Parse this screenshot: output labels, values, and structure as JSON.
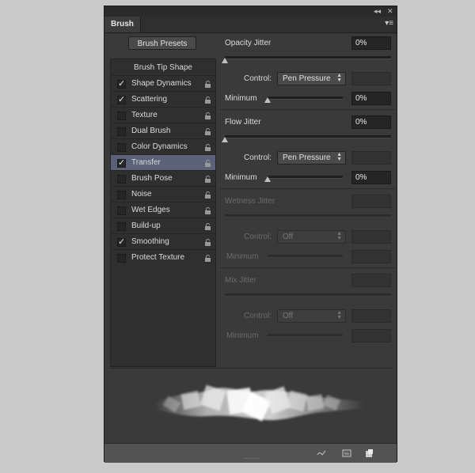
{
  "panel": {
    "tab_title": "Brush",
    "collapse_glyph": "◂◂",
    "close_glyph": "✕",
    "menu_glyph": "▾≡"
  },
  "brush_presets_button": "Brush Presets",
  "brush_list": {
    "heading": "Brush Tip Shape",
    "items": [
      {
        "label": "Shape Dynamics",
        "checked": "✓"
      },
      {
        "label": "Scattering",
        "checked": "✓"
      },
      {
        "label": "Texture",
        "checked": ""
      },
      {
        "label": "Dual Brush",
        "checked": ""
      },
      {
        "label": "Color Dynamics",
        "checked": ""
      },
      {
        "label": "Transfer",
        "checked": "✓"
      },
      {
        "label": "Brush Pose",
        "checked": ""
      },
      {
        "label": "Noise",
        "checked": ""
      },
      {
        "label": "Wet Edges",
        "checked": ""
      },
      {
        "label": "Build-up",
        "checked": ""
      },
      {
        "label": "Smoothing",
        "checked": "✓"
      },
      {
        "label": "Protect Texture",
        "checked": ""
      }
    ]
  },
  "transfer": {
    "opacity": {
      "label": "Opacity Jitter",
      "value": "0%",
      "control_label": "Control:",
      "control_value": "Pen Pressure",
      "minimum_label": "Minimum",
      "minimum_value": "0%"
    },
    "flow": {
      "label": "Flow Jitter",
      "value": "0%",
      "control_label": "Control:",
      "control_value": "Pen Pressure",
      "minimum_label": "Minimum",
      "minimum_value": "0%"
    },
    "wetness": {
      "label": "Wetness Jitter",
      "control_label": "Control:",
      "control_value": "Off",
      "minimum_label": "Minimum"
    },
    "mix": {
      "label": "Mix Jitter",
      "control_label": "Control:",
      "control_value": "Off",
      "minimum_label": "Minimum"
    }
  },
  "colors": {
    "selected_row": "#5a6178",
    "panel_bg": "#3a3a3a"
  }
}
